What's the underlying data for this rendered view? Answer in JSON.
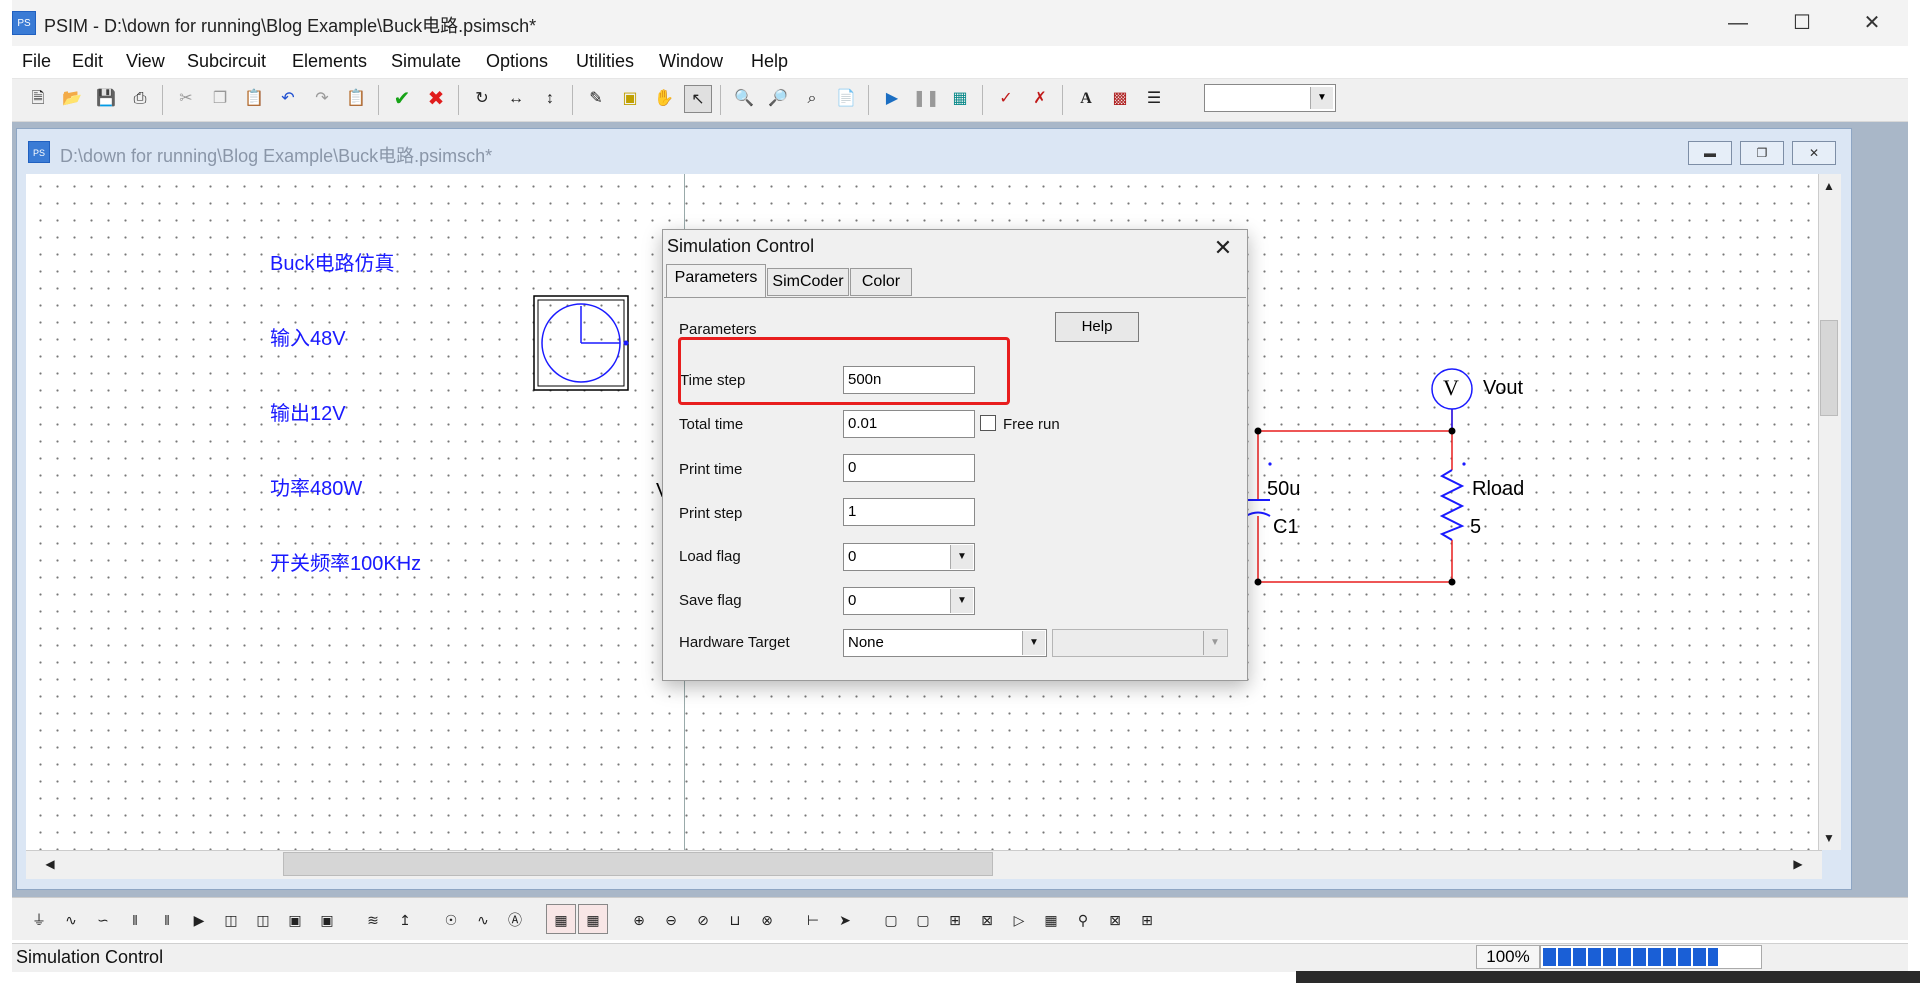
{
  "window": {
    "title": "PSIM - D:\\down for running\\Blog Example\\Buck电路.psimsch*",
    "icon": "psim-app-icon"
  },
  "menu": [
    "File",
    "Edit",
    "View",
    "Subcircuit",
    "Elements",
    "Simulate",
    "Options",
    "Utilities",
    "Window",
    "Help"
  ],
  "child_window": {
    "title": "D:\\down for running\\Blog Example\\Buck电路.psimsch*"
  },
  "notes": [
    "Buck电路仿真",
    "输入48V",
    "输出12V",
    "功率480W",
    "开关频率100KHz"
  ],
  "circuit": {
    "voltmeter_symbol": "V",
    "voltmeter_label": "Vout",
    "cap_value": "50u",
    "cap_name": "C1",
    "res_name": "Rload",
    "res_value": "5",
    "partial_label": "V"
  },
  "dialog": {
    "title": "Simulation Control",
    "tabs": [
      "Parameters",
      "SimCoder",
      "Color"
    ],
    "section": "Parameters",
    "help": "Help",
    "fields": {
      "time_step": {
        "label": "Time step",
        "value": "500n"
      },
      "total_time": {
        "label": "Total time",
        "value": "0.01"
      },
      "free_run": {
        "label": "Free run",
        "checked": false
      },
      "print_time": {
        "label": "Print time",
        "value": "0"
      },
      "print_step": {
        "label": "Print step",
        "value": "1"
      },
      "load_flag": {
        "label": "Load flag",
        "value": "0"
      },
      "save_flag": {
        "label": "Save flag",
        "value": "0"
      },
      "hardware_target": {
        "label": "Hardware Target",
        "value": "None"
      }
    }
  },
  "status": {
    "text": "Simulation Control",
    "zoom": "100%",
    "progress": 0.81
  },
  "colors": {
    "annotation": "#1a1aff",
    "wire": "#e81e1e",
    "highlight": "#e81e1e",
    "progress": "#1a5fd6"
  }
}
